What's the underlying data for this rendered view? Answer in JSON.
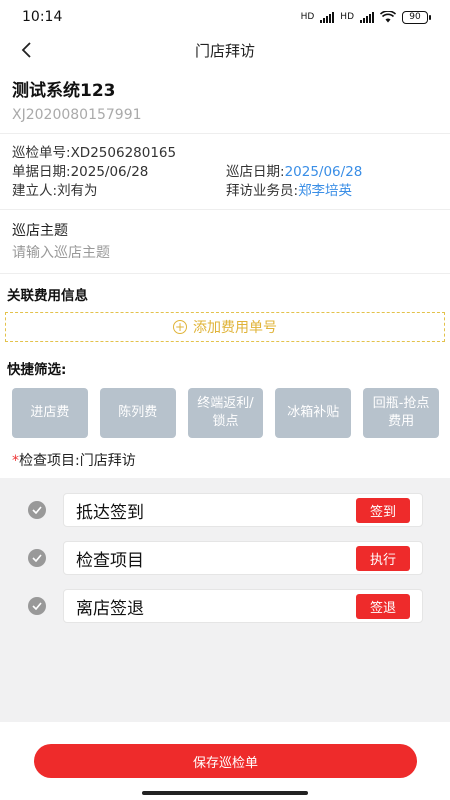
{
  "status_bar": {
    "time": "10:14",
    "battery": "90",
    "hd1": "HD",
    "hd2": "HD"
  },
  "nav": {
    "title": "门店拜访"
  },
  "store": {
    "name": "测试系统123",
    "code": "XJ2020080157991"
  },
  "info": {
    "inspection_no_label": "巡检单号:",
    "inspection_no": "XD2506280165",
    "doc_date_label": "单据日期:",
    "doc_date": "2025/06/28",
    "visit_date_label": "巡店日期:",
    "visit_date": "2025/06/28",
    "creator_label": "建立人:",
    "creator": "刘有为",
    "salesman_label": "拜访业务员:",
    "salesman": "郑李培英"
  },
  "topic": {
    "label": "巡店主题",
    "placeholder": "请输入巡店主题"
  },
  "fee": {
    "section_title": "关联费用信息",
    "add_label": "添加费用单号"
  },
  "filters": {
    "title": "快捷筛选:",
    "items": [
      "进店费",
      "陈列费",
      "终端返利/锁点",
      "冰箱补贴",
      "回瓶-抢点费用"
    ]
  },
  "check": {
    "required_mark": "*",
    "title": "检查项目:门店拜访",
    "items": [
      {
        "name": "抵达签到",
        "action": "签到"
      },
      {
        "name": "检查项目",
        "action": "执行"
      },
      {
        "name": "离店签退",
        "action": "签退"
      }
    ]
  },
  "footer": {
    "save_label": "保存巡检单"
  },
  "colors": {
    "accent_red": "#ee2b2b",
    "link_blue": "#3a8ee6",
    "fee_yellow": "#e0b43a",
    "filter_gray": "#b7c2cc"
  }
}
